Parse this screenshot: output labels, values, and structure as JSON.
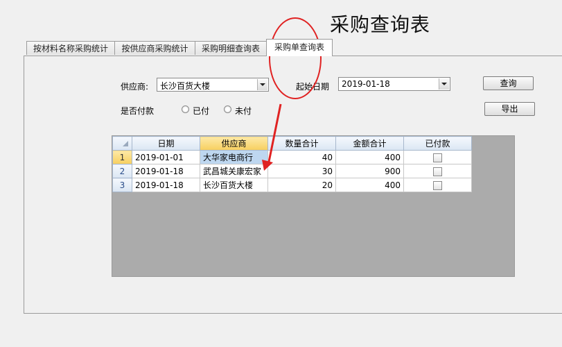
{
  "header": {
    "title": "采购查询表"
  },
  "tabs": [
    {
      "label": "按材料名称采购统计"
    },
    {
      "label": "按供应商采购统计"
    },
    {
      "label": "采购明细查询表"
    },
    {
      "label": "采购单查询表"
    }
  ],
  "filters": {
    "supplier_label": "供应商:",
    "supplier_value": "长沙百货大楼",
    "start_date_label": "起始日期",
    "start_date_value": "2019-01-18",
    "paid_label": "是否付款",
    "paid_option": "已付",
    "unpaid_option": "未付"
  },
  "buttons": {
    "query": "查询",
    "export": "导出"
  },
  "grid": {
    "columns": [
      "日期",
      "供应商",
      "数量合计",
      "金额合计",
      "已付款"
    ],
    "rows": [
      {
        "no": "1",
        "date": "2019-01-01",
        "supplier": "大华家电商行",
        "qty": "40",
        "amount": "400"
      },
      {
        "no": "2",
        "date": "2019-01-18",
        "supplier": "武昌城关康宏家",
        "qty": "30",
        "amount": "900"
      },
      {
        "no": "3",
        "date": "2019-01-18",
        "supplier": "长沙百货大楼",
        "qty": "20",
        "amount": "400"
      }
    ]
  },
  "colors": {
    "annotation": "#e02222",
    "header_selected": "#f7cf5e",
    "cell_selected": "#bed7f0"
  }
}
